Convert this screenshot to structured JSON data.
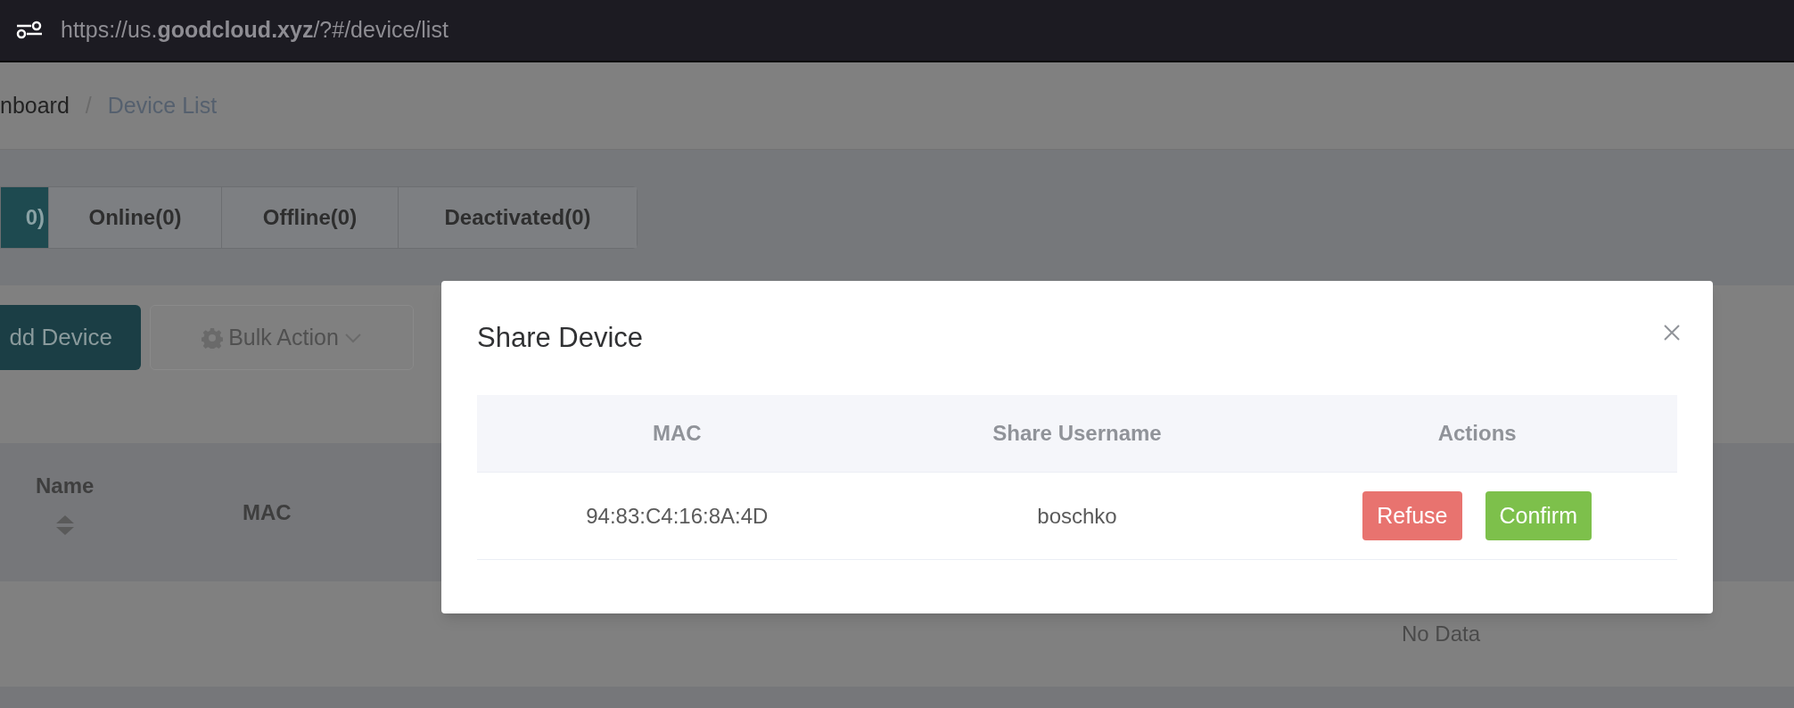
{
  "browser": {
    "url": "https://us.**goodcloud.xyz**/?#/device/list"
  },
  "breadcrumb": {
    "items": [
      {
        "label": "nboard",
        "current": false
      },
      {
        "label": "Device List",
        "current": true
      }
    ],
    "separator": "/"
  },
  "tabs": [
    {
      "label": "0)",
      "selected": true
    },
    {
      "label": "Online(0)",
      "selected": false
    },
    {
      "label": "Offline(0)",
      "selected": false
    },
    {
      "label": "Deactivated(0)",
      "selected": false
    }
  ],
  "toolbar": {
    "add_button": "dd Device",
    "bulk_action": "Bulk Action"
  },
  "table": {
    "columns": [
      {
        "label": "Name",
        "sortable": true
      },
      {
        "label": "MAC",
        "sortable": false
      }
    ],
    "empty_text": "No Data"
  },
  "modal": {
    "title": "Share Device",
    "columns": [
      "MAC",
      "Share Username",
      "Actions"
    ],
    "rows": [
      {
        "mac": "94:83:C4:16:8A:4D",
        "username": "boschko",
        "actions": [
          {
            "label": "Refuse",
            "kind": "refuse"
          },
          {
            "label": "Confirm",
            "kind": "confirm"
          }
        ]
      }
    ]
  }
}
